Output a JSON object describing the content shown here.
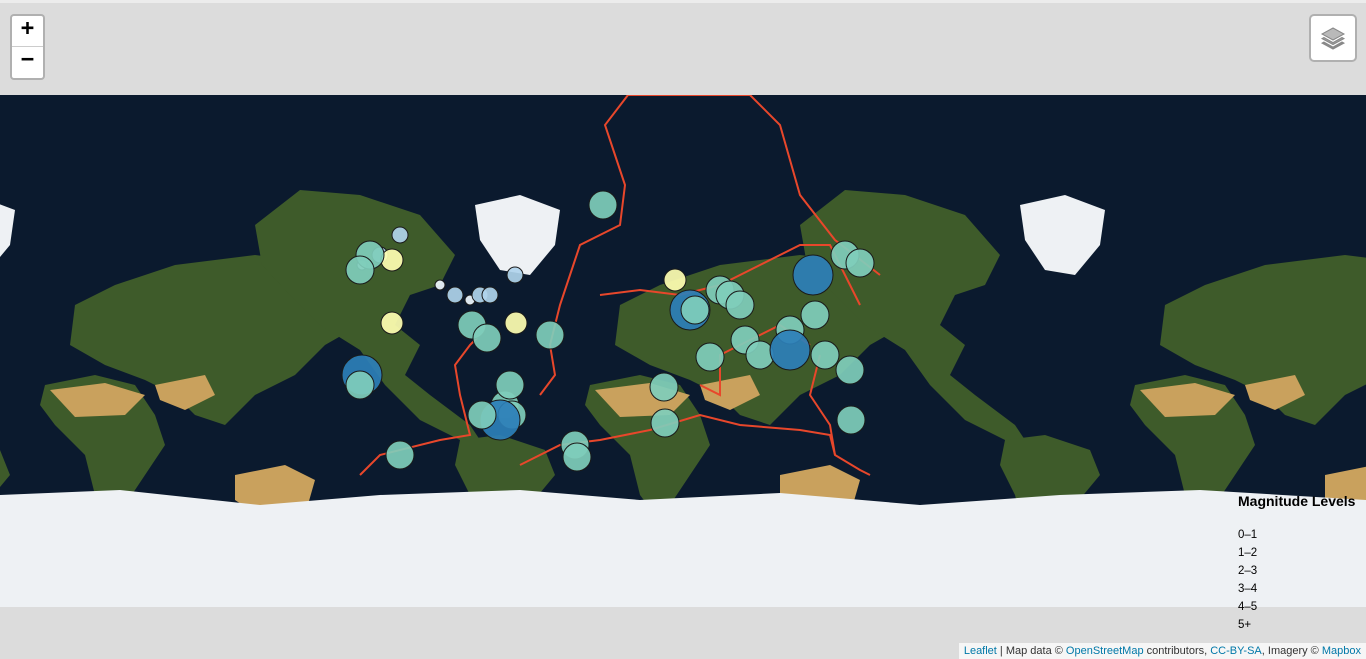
{
  "controls": {
    "zoom_in": "+",
    "zoom_out": "−",
    "layers_icon": "layers-icon"
  },
  "legend": {
    "title": "Magnitude Levels",
    "levels": [
      {
        "label": "0–1",
        "color": "#f0f8ff"
      },
      {
        "label": "1–2",
        "color": "#b0d4ec"
      },
      {
        "label": "2–3",
        "color": "#ffffb2"
      },
      {
        "label": "3–4",
        "color": "#7fcdbb"
      },
      {
        "label": "4–5",
        "color": "#41b6c4"
      },
      {
        "label": "5+",
        "color": "#2c7fb8"
      }
    ]
  },
  "attribution": {
    "leaflet": "Leaflet",
    "sep1": " | Map data © ",
    "osm": "OpenStreetMap",
    "sep2": " contributors, ",
    "license": "CC-BY-SA",
    "sep3": ", Imagery © ",
    "mapbox": "Mapbox"
  },
  "colors": {
    "ocean": "#0b1a2e",
    "land_green": "#3e5b2a",
    "land_desert": "#c9a15d",
    "ice": "#eef1f4",
    "plates": "#e8472b",
    "marker_outline": "#1a1a1a"
  }
}
